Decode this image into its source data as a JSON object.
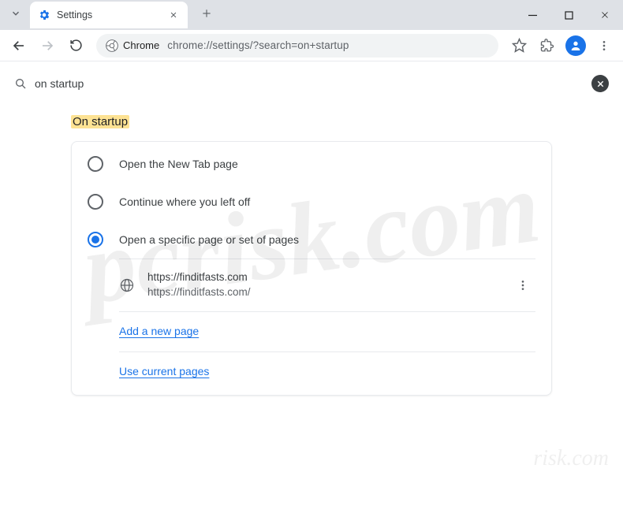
{
  "window": {
    "tab_title": "Settings"
  },
  "toolbar": {
    "url_chip": "Chrome",
    "url": "chrome://settings/?search=on+startup"
  },
  "search": {
    "query": "on startup"
  },
  "section": {
    "title": "On startup"
  },
  "options": {
    "o1": "Open the New Tab page",
    "o2": "Continue where you left off",
    "o3": "Open a specific page or set of pages"
  },
  "startup_page": {
    "title": "https://finditfasts.com",
    "url": "https://finditfasts.com/"
  },
  "links": {
    "add": "Add a new page",
    "use_current": "Use current pages"
  },
  "watermark": {
    "main": "pcrisk.com",
    "sub": "risk.com"
  }
}
